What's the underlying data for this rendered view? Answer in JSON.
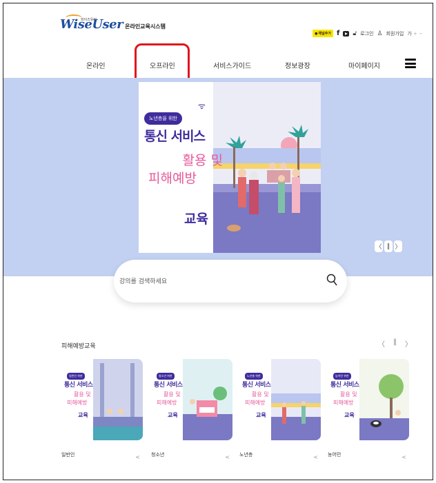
{
  "header": {
    "logo_top": "와이즈유저",
    "logo_mark": "WiseUser",
    "logo_text": "온라인교육시스템",
    "kakao_label": "채널추가",
    "facebook": "f",
    "login": "로그인",
    "signup": "회원가입",
    "font_size_label": "가",
    "font_plus": "+",
    "font_minus": "−"
  },
  "nav": {
    "items": [
      "온라인",
      "오프라인",
      "서비스가이드",
      "정보광장",
      "마이페이지"
    ]
  },
  "banner": {
    "pill": "노년층을 위한",
    "title_line1": "통신 서비스",
    "title_line2": "활용 및",
    "title_line3": "피해예방",
    "title_line4": "교육",
    "ctrl_prev": "〈",
    "ctrl_pause": "‖",
    "ctrl_next": "〉"
  },
  "search": {
    "placeholder": "강의를 검색하세요"
  },
  "prevention": {
    "title": "피해예방교육",
    "prev": "〈",
    "pause": "‖",
    "next": "〉",
    "courses": [
      {
        "label": "일반인",
        "pill": "일반인 위한",
        "t1": "통신 서비스",
        "t2": "활용 및",
        "t3": "피해예방",
        "t4": "교육"
      },
      {
        "label": "청소년",
        "pill": "청소년 위한",
        "t1": "통신 서비스",
        "t2": "활용 및",
        "t3": "피해예방",
        "t4": "교육"
      },
      {
        "label": "노년층",
        "pill": "노년층 위한",
        "t1": "통신 서비스",
        "t2": "활용 및",
        "t3": "피해예방",
        "t4": "교육"
      },
      {
        "label": "농어민",
        "pill": "농어민 위한",
        "t1": "통신 서비스",
        "t2": "활용 및",
        "t3": "피해예방",
        "t4": "교육"
      }
    ]
  },
  "colors": {
    "brand_purple": "#3e2d9c",
    "brand_pink": "#e65a9a",
    "banner_bg": "#c2d0f1",
    "highlight": "#e0141b"
  }
}
